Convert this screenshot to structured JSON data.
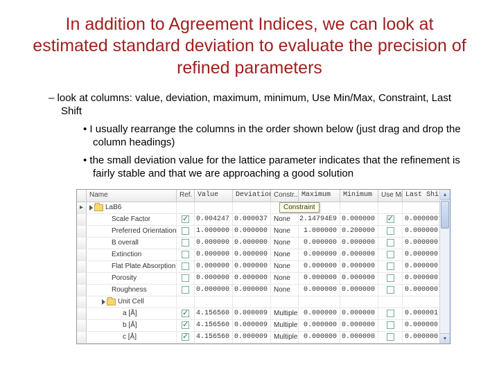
{
  "title": "In addition to Agreement Indices, we can look at estimated standard deviation to evaluate the precision of refined parameters",
  "bullets": {
    "l1": "look at columns: value, deviation, maximum, minimum, Use Min/Max, Constraint, Last Shift",
    "l2a": "I usually rearrange the columns in the order shown below (just drag and drop the column headings)",
    "l2b": "the small deviation value for the lattice parameter indicates that the refinement is fairly stable and that we are approaching a good solution"
  },
  "tooltip": "Constraint",
  "columns": {
    "name": "Name",
    "ref": "Ref.",
    "value": "Value",
    "deviation": "Deviation",
    "constr": "Constr..",
    "max": "Maximum",
    "min": "Minimum",
    "usemm": "Use Mi..",
    "lastshift": "Last Shift"
  },
  "rows": [
    {
      "kind": "group",
      "name": "LaB6",
      "ref": false,
      "val": "",
      "dev": "",
      "con": "",
      "max": "",
      "min": "",
      "use": false,
      "shift": "",
      "mark": "▸"
    },
    {
      "kind": "param",
      "name": "Scale Factor",
      "ref": true,
      "val": "0.004247",
      "dev": "0.000037",
      "con": "None",
      "max": "2.14794E9",
      "min": "0.000000",
      "use": true,
      "shift": "0.000000"
    },
    {
      "kind": "param",
      "name": "Preferred Orientation",
      "ref": false,
      "val": "1.000000",
      "dev": "0.000000",
      "con": "None",
      "max": "1.000000",
      "min": "0.200000",
      "use": false,
      "shift": "0.000000"
    },
    {
      "kind": "param",
      "name": "B overall",
      "ref": false,
      "val": "0.000000",
      "dev": "0.000000",
      "con": "None",
      "max": "0.000000",
      "min": "0.000000",
      "use": false,
      "shift": "0.000000"
    },
    {
      "kind": "param",
      "name": "Extinction",
      "ref": false,
      "val": "0.000000",
      "dev": "0.000000",
      "con": "None",
      "max": "0.000000",
      "min": "0.000000",
      "use": false,
      "shift": "0.000000"
    },
    {
      "kind": "param",
      "name": "Flat Plate Absorption C..",
      "ref": false,
      "val": "0.000000",
      "dev": "0.000000",
      "con": "None",
      "max": "0.000000",
      "min": "0.000000",
      "use": false,
      "shift": "0.000000"
    },
    {
      "kind": "param",
      "name": "Porosity",
      "ref": false,
      "val": "0.000000",
      "dev": "0.000000",
      "con": "None",
      "max": "0.000000",
      "min": "0.000000",
      "use": false,
      "shift": "0.000000"
    },
    {
      "kind": "param",
      "name": "Roughness",
      "ref": false,
      "val": "0.000000",
      "dev": "0.000000",
      "con": "None",
      "max": "0.000000",
      "min": "0.000000",
      "use": false,
      "shift": "0.000000"
    },
    {
      "kind": "subgroup",
      "name": "Unit Cell",
      "ref": false,
      "val": "",
      "dev": "",
      "con": "",
      "max": "",
      "min": "",
      "use": false,
      "shift": ""
    },
    {
      "kind": "sub",
      "name": "a [Å]",
      "ref": true,
      "val": "4.156560",
      "dev": "0.000009",
      "con": "Multiple..",
      "max": "0.000000",
      "min": "0.000000",
      "use": false,
      "shift": "0.000001"
    },
    {
      "kind": "sub",
      "name": "b [Å]",
      "ref": true,
      "val": "4.156560",
      "dev": "0.000009",
      "con": "Multiple..",
      "max": "0.000000",
      "min": "0.000000",
      "use": false,
      "shift": "0.000000"
    },
    {
      "kind": "sub",
      "name": "c [Å]",
      "ref": true,
      "val": "4.156560",
      "dev": "0.000009",
      "con": "Multiple..",
      "max": "0.000000",
      "min": "0.000000",
      "use": false,
      "shift": "0.000000"
    }
  ]
}
